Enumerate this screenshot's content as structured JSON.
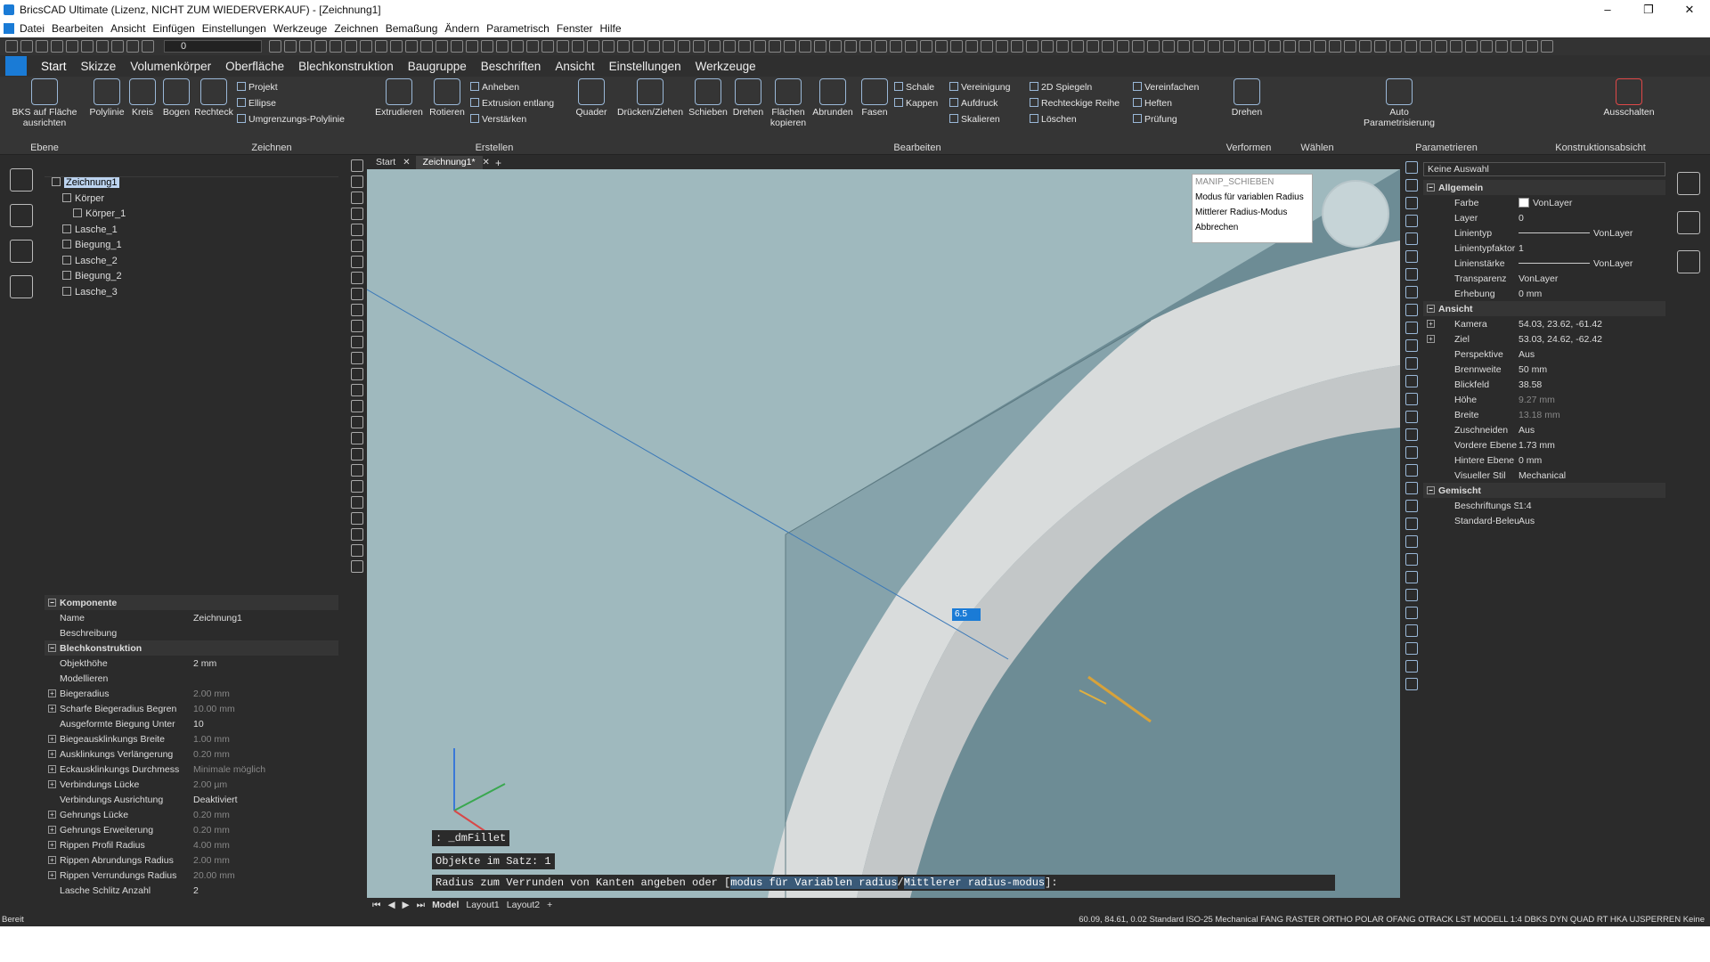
{
  "window": {
    "title": "BricsCAD Ultimate (Lizenz, NICHT ZUM WIEDERVERKAUF) - [Zeichnung1]",
    "controls": [
      "–",
      "❐",
      "✕"
    ]
  },
  "menubar": [
    "Datei",
    "Bearbeiten",
    "Ansicht",
    "Einfügen",
    "Einstellungen",
    "Werkzeuge",
    "Zeichnen",
    "Bemaßung",
    "Ändern",
    "Parametrisch",
    "Fenster",
    "Hilfe"
  ],
  "toolbar": {
    "layer_value": "0"
  },
  "ribbon_tabs": [
    "Start",
    "Skizze",
    "Volumenkörper",
    "Oberfläche",
    "Blechkonstruktion",
    "Baugruppe",
    "Beschriften",
    "Ansicht",
    "Einstellungen",
    "Werkzeuge"
  ],
  "ribbon": {
    "groups": {
      "ebene": "Ebene",
      "zeichnen": "Zeichnen",
      "erstellen": "Erstellen",
      "bearbeiten": "Bearbeiten",
      "verformen": "Verformen",
      "waehlen": "Wählen",
      "parametrieren": "Parametrieren",
      "konstruktionsabsicht": "Konstruktionsabsicht"
    },
    "buttons": {
      "bks": "BKS auf Fläche ausrichten",
      "polylinie": "Polylinie",
      "kreis": "Kreis",
      "bogen": "Bogen",
      "rechteck": "Rechteck",
      "projekt": "Projekt",
      "ellipse": "Ellipse",
      "umgrenzung": "Umgrenzungs-Polylinie",
      "extrudieren": "Extrudieren",
      "rotieren": "Rotieren",
      "anheben": "Anheben",
      "extrusion_entlang": "Extrusion entlang",
      "verstaerken": "Verstärken",
      "quader": "Quader",
      "druecken": "Drücken/Ziehen",
      "schieben": "Schieben",
      "drehen": "Drehen",
      "flaechen_kopieren": "Flächen kopieren",
      "abrunden": "Abrunden",
      "fasen": "Fasen",
      "schale": "Schale",
      "kappen": "Kappen",
      "vereinigung": "Vereinigung",
      "aufdruck": "Aufdruck",
      "skalieren": "Skalieren",
      "spiegeln2d": "2D Spiegeln",
      "rechteckige_reihe": "Rechteckige Reihe",
      "loeschen": "Löschen",
      "vereinfachen": "Vereinfachen",
      "heften": "Heften",
      "pruefung": "Prüfung",
      "drehen2": "Drehen",
      "auto_param": "Auto Parametrisierung",
      "ausschalten": "Ausschalten"
    }
  },
  "drawing_tree": {
    "nodes": [
      {
        "label": "Zeichnung1",
        "level": 0
      },
      {
        "label": "Körper",
        "level": 1
      },
      {
        "label": "Körper_1",
        "level": 2
      },
      {
        "label": "Lasche_1",
        "level": 1
      },
      {
        "label": "Biegung_1",
        "level": 1
      },
      {
        "label": "Lasche_2",
        "level": 1
      },
      {
        "label": "Biegung_2",
        "level": 1
      },
      {
        "label": "Lasche_3",
        "level": 1
      }
    ]
  },
  "component_panel": {
    "rows": [
      {
        "k": "Komponente",
        "v": "",
        "type": "sect"
      },
      {
        "k": "Name",
        "v": "Zeichnung1"
      },
      {
        "k": "Beschreibung",
        "v": ""
      },
      {
        "k": "Blechkonstruktion",
        "v": "",
        "type": "sect"
      },
      {
        "k": "Objekthöhe",
        "v": "2 mm"
      },
      {
        "k": "Modellieren",
        "v": "",
        "type": "sub"
      },
      {
        "k": "Biegeradius",
        "v": "2.00 mm",
        "dim": true,
        "exp": true
      },
      {
        "k": "Scharfe Biegeradius Begren",
        "v": "10.00 mm",
        "dim": true,
        "exp": true
      },
      {
        "k": "Ausgeformte Biegung Unter",
        "v": "10"
      },
      {
        "k": "Biegeausklinkungs Breite",
        "v": "1.00 mm",
        "dim": true,
        "exp": true
      },
      {
        "k": "Ausklinkungs Verlängerung",
        "v": "0.20 mm",
        "dim": true,
        "exp": true
      },
      {
        "k": "Eckausklinkungs Durchmess",
        "v": "Minimale möglich",
        "dim": true,
        "exp": true
      },
      {
        "k": "Verbindungs Lücke",
        "v": "2.00 µm",
        "dim": true,
        "exp": true
      },
      {
        "k": "Verbindungs Ausrichtung",
        "v": "Deaktiviert"
      },
      {
        "k": "Gehrungs Lücke",
        "v": "0.20 mm",
        "dim": true,
        "exp": true
      },
      {
        "k": "Gehrungs Erweiterung",
        "v": "0.20 mm",
        "dim": true,
        "exp": true
      },
      {
        "k": "Rippen Profil Radius",
        "v": "4.00 mm",
        "dim": true,
        "exp": true
      },
      {
        "k": "Rippen Abrundungs Radius",
        "v": "2.00 mm",
        "dim": true,
        "exp": true
      },
      {
        "k": "Rippen Verrundungs Radius",
        "v": "20.00 mm",
        "dim": true,
        "exp": true
      },
      {
        "k": "Lasche Schlitz Anzahl",
        "v": "2"
      }
    ]
  },
  "doc_tabs": [
    "Start",
    "Zeichnung1*"
  ],
  "manip_menu": {
    "header": "MANIP_SCHIEBEN",
    "items": [
      "Modus für variablen Radius",
      "Mittlerer Radius-Modus",
      "Abbrechen"
    ]
  },
  "viewport": {
    "dim_input": "6.5"
  },
  "command": {
    "line1": ": _dmFillet",
    "line2": "Objekte im Satz: 1",
    "prompt_pre": "Radius zum Verrunden von Kanten angeben oder [",
    "opt1": "modus für Variablen radius",
    "sep": "/",
    "opt2": "Mittlerer radius-modus",
    "prompt_post": "]:"
  },
  "layout_tabs": [
    "Model",
    "Layout1",
    "Layout2",
    "+"
  ],
  "properties": {
    "selection": "Keine Auswahl",
    "rows": [
      {
        "k": "Allgemein",
        "v": "",
        "type": "sect"
      },
      {
        "k": "Farbe",
        "v": "VonLayer",
        "swatch": true
      },
      {
        "k": "Layer",
        "v": "0"
      },
      {
        "k": "Linientyp",
        "v": "VonLayer",
        "line": true
      },
      {
        "k": "Linientypfaktor",
        "v": "1"
      },
      {
        "k": "Linienstärke",
        "v": "VonLayer",
        "line": true
      },
      {
        "k": "Transparenz",
        "v": "VonLayer"
      },
      {
        "k": "Erhebung",
        "v": "0 mm"
      },
      {
        "k": "Ansicht",
        "v": "",
        "type": "sect"
      },
      {
        "k": "Kamera",
        "v": "54.03, 23.62, -61.42",
        "exp": true
      },
      {
        "k": "Ziel",
        "v": "53.03, 24.62, -62.42",
        "exp": true
      },
      {
        "k": "Perspektive",
        "v": "Aus"
      },
      {
        "k": "Brennweite",
        "v": "50 mm"
      },
      {
        "k": "Blickfeld",
        "v": "38.58"
      },
      {
        "k": "Höhe",
        "v": "9.27 mm",
        "dim": true
      },
      {
        "k": "Breite",
        "v": "13.18 mm",
        "dim": true
      },
      {
        "k": "Zuschneiden",
        "v": "Aus"
      },
      {
        "k": "Vordere Ebene",
        "v": "1.73 mm"
      },
      {
        "k": "Hintere Ebene",
        "v": "0 mm"
      },
      {
        "k": "Visueller Stil",
        "v": "Mechanical"
      },
      {
        "k": "Gemischt",
        "v": "",
        "type": "sect"
      },
      {
        "k": "Beschriftungs Skali",
        "v": "1:4"
      },
      {
        "k": "Standard-Beleucht",
        "v": "Aus"
      }
    ]
  },
  "statusbar": {
    "left": "Bereit",
    "right": "60.09, 84.61, 0.02 Standard ISO-25 Mechanical FANG RASTER ORTHO POLAR OFANG OTRACK LST MODELL 1:4 DBKS DYN QUAD RT HKA UJSPERREN Keine"
  },
  "colors": {
    "accent": "#1a7bd6",
    "viewport_bg": "#9fb9be",
    "panel_bg": "#2b2b2b"
  }
}
